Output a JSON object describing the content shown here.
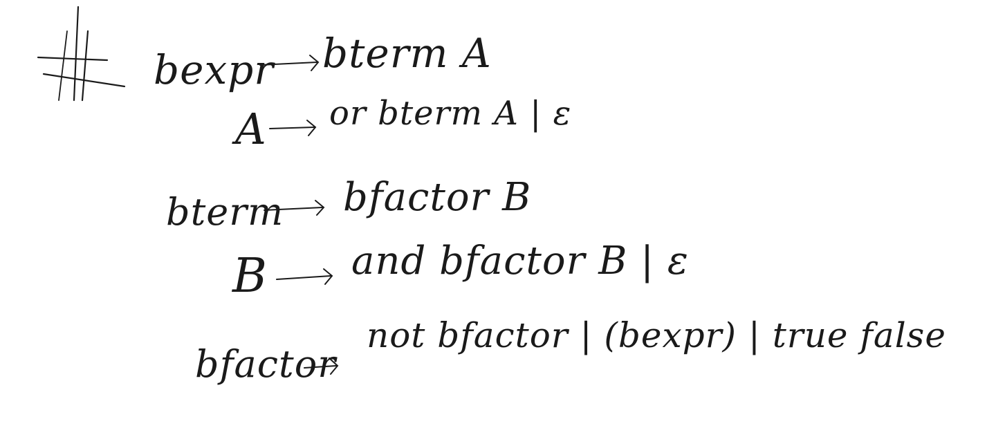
{
  "ink_color": "#1a1a1a",
  "background_color": "#ffffff",
  "grammar": {
    "marker": "#",
    "lines": [
      {
        "lhs": "bexpr",
        "arrow": "→",
        "rhs": "bterm A"
      },
      {
        "lhs": "A",
        "arrow": "→",
        "rhs": "or bterm A | ε"
      },
      {
        "lhs": "bterm",
        "arrow": "→",
        "rhs": "bfactor B"
      },
      {
        "lhs": "B",
        "arrow": "→",
        "rhs": "and bfactor B | ε"
      },
      {
        "lhs": "bfactor",
        "arrow": "→",
        "rhs": "not bfactor | (bexpr) | true false"
      }
    ]
  }
}
